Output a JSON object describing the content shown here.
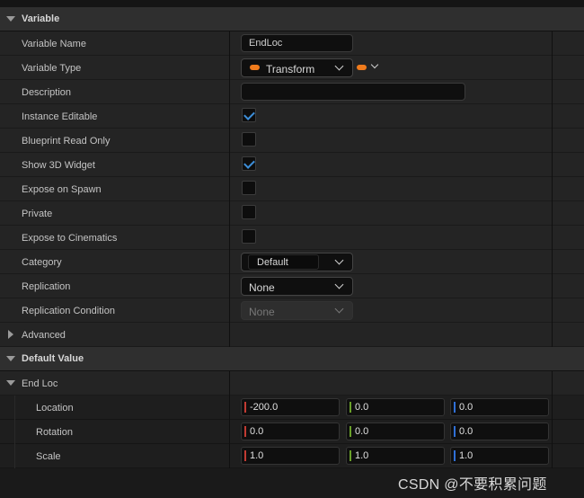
{
  "sections": {
    "variable": "Variable",
    "default_value": "Default Value"
  },
  "labels": {
    "variable_name": "Variable Name",
    "variable_type": "Variable Type",
    "description": "Description",
    "instance_editable": "Instance Editable",
    "blueprint_read_only": "Blueprint Read Only",
    "show_3d_widget": "Show 3D Widget",
    "expose_on_spawn": "Expose on Spawn",
    "private": "Private",
    "expose_to_cinematics": "Expose to Cinematics",
    "category": "Category",
    "replication": "Replication",
    "replication_condition": "Replication Condition",
    "advanced": "Advanced",
    "end_loc": "End Loc",
    "location": "Location",
    "rotation": "Rotation",
    "scale": "Scale"
  },
  "values": {
    "variable_name": "EndLoc",
    "variable_type": "Transform",
    "description": "",
    "category": "Default",
    "replication": "None",
    "replication_condition": "None"
  },
  "checkboxes": {
    "instance_editable": true,
    "blueprint_read_only": false,
    "show_3d_widget": true,
    "expose_on_spawn": false,
    "private": false,
    "expose_to_cinematics": false
  },
  "transform": {
    "location": [
      "-200.0",
      "0.0",
      "0.0"
    ],
    "rotation": [
      "0.0",
      "0.0",
      "0.0"
    ],
    "scale": [
      "1.0",
      "1.0",
      "1.0"
    ]
  },
  "colors": {
    "type_pill": "#f07b1c",
    "axis_x": "#c23b33",
    "axis_y": "#6aa12a",
    "axis_z": "#2f6fd6",
    "checkmark": "#3d8ed8"
  },
  "watermark": "CSDN @不要积累问题"
}
